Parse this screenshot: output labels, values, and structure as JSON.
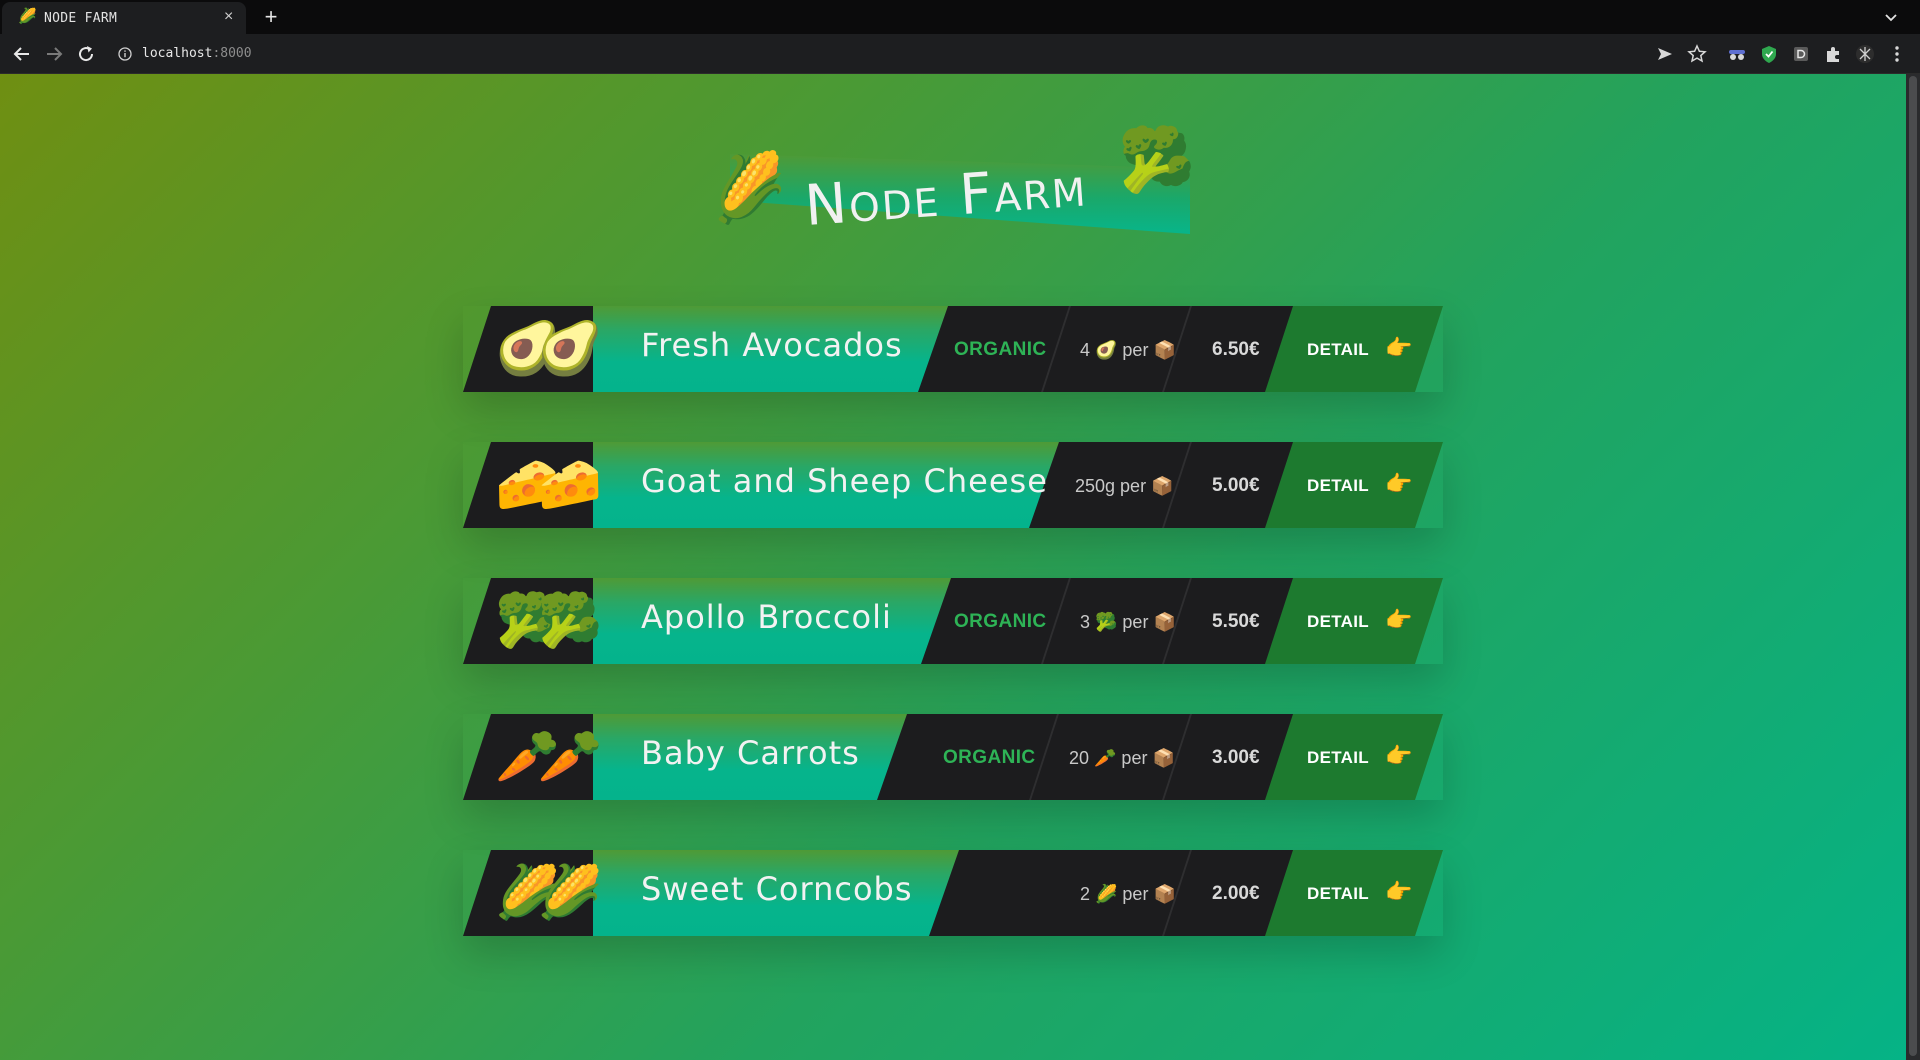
{
  "browser": {
    "tab_favicon": "🌽",
    "tab_title": "NODE FARM",
    "tab_close": "×",
    "new_tab": "+",
    "address_host": "localhost",
    "address_port": ":8000"
  },
  "page": {
    "title_left_emoji": "🌽",
    "title": "Node Farm",
    "title_right_emoji": "🥦",
    "accent_green": "#1d7a2f",
    "organic_color": "#2eb356"
  },
  "products": [
    {
      "emoji": "🥑🥑",
      "name": "Fresh Avocados",
      "organic": "ORGANIC",
      "qty": "4 🥑 per 📦",
      "price": "6.50€",
      "detail": "DETAIL",
      "detail_icon": "👉"
    },
    {
      "emoji": "🧀🧀",
      "name": "Goat and Sheep Cheese",
      "organic": "",
      "qty": "250g per 📦",
      "price": "5.00€",
      "detail": "DETAIL",
      "detail_icon": "👉"
    },
    {
      "emoji": "🥦🥦",
      "name": "Apollo Broccoli",
      "organic": "ORGANIC",
      "qty": "3 🥦 per 📦",
      "price": "5.50€",
      "detail": "DETAIL",
      "detail_icon": "👉"
    },
    {
      "emoji": "🥕🥕",
      "name": "Baby Carrots",
      "organic": "ORGANIC",
      "qty": "20 🥕 per 📦",
      "price": "3.00€",
      "detail": "DETAIL",
      "detail_icon": "👉"
    },
    {
      "emoji": "🌽🌽",
      "name": "Sweet Corncobs",
      "organic": "",
      "qty": "2 🌽 per 📦",
      "price": "2.00€",
      "detail": "DETAIL",
      "detail_icon": "👉"
    }
  ]
}
